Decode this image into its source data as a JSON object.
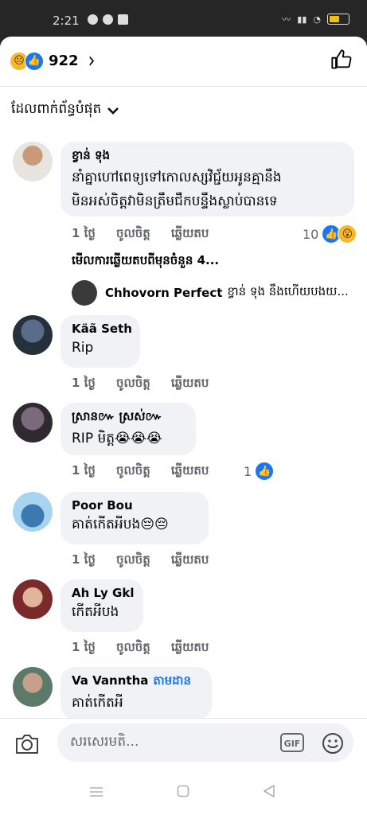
{
  "status_bar": {
    "time": "2:21",
    "battery_level": 0.6
  },
  "header": {
    "reaction_count": "922",
    "reaction_icons": [
      "sad-reaction-icon",
      "like-reaction-icon"
    ]
  },
  "sort": {
    "label": "ដែលពាក់ព័ន្ធបំផុត"
  },
  "comments": [
    {
      "author": "ខ្វាន់ ទុង",
      "text_lines": [
        "នាំគ្នាហៅពេទ្យទៅកោលស្សវិជ្ជ័យអូនគ្មានឹង",
        "មិនអស់ចិត្តវាមិនត្រឹមជឹកបន្ទឹងស្លាប់បានទេ"
      ],
      "time": "1 ថ្ងៃ",
      "like": "ចូលចិត្ត",
      "reply": "ឆ្លើយតប",
      "reaction_count": "10",
      "view_replies": "មើលការឆ្លើយតបពីមុនចំនួន 4...",
      "reply_preview": {
        "author": "Chhovorn Perfect",
        "text": "ខ្វាន់ ទុង នឹងហើយបងយ..."
      }
    },
    {
      "author": "Käã Seth",
      "text_lines": [
        "Rip"
      ],
      "time": "1 ថ្ងៃ",
      "like": "ចូលចិត្ត",
      "reply": "ឆ្លើយតប"
    },
    {
      "author": "ស្រាន៚ ស្រស់៚",
      "text_lines": [
        "RIP មិត្ត😭😭😭"
      ],
      "time": "1 ថ្ងៃ",
      "like": "ចូលចិត្ត",
      "reply": "ឆ្លើយតប",
      "reaction_count": "1"
    },
    {
      "author": "Poor Bou",
      "text_lines": [
        "គាត់កើតអីបង😔😔"
      ],
      "time": "1 ថ្ងៃ",
      "like": "ចូលចិត្ត",
      "reply": "ឆ្លើយតប"
    },
    {
      "author": "Ah Ly Gkl",
      "text_lines": [
        "កើតអីបង"
      ],
      "time": "1 ថ្ងៃ",
      "like": "ចូលចិត្ត",
      "reply": "ឆ្លើយតប"
    },
    {
      "author": "Va Vanntha",
      "follow": "តាមដាន",
      "text_lines": [
        "គាត់កើតអី"
      ]
    }
  ],
  "composer": {
    "placeholder": "សរសេរមតិ...",
    "gif_label": "GIF"
  },
  "colors": {
    "accent": "#1877f2",
    "bubble": "#f0f2f5",
    "secondary_text": "#65676b"
  }
}
